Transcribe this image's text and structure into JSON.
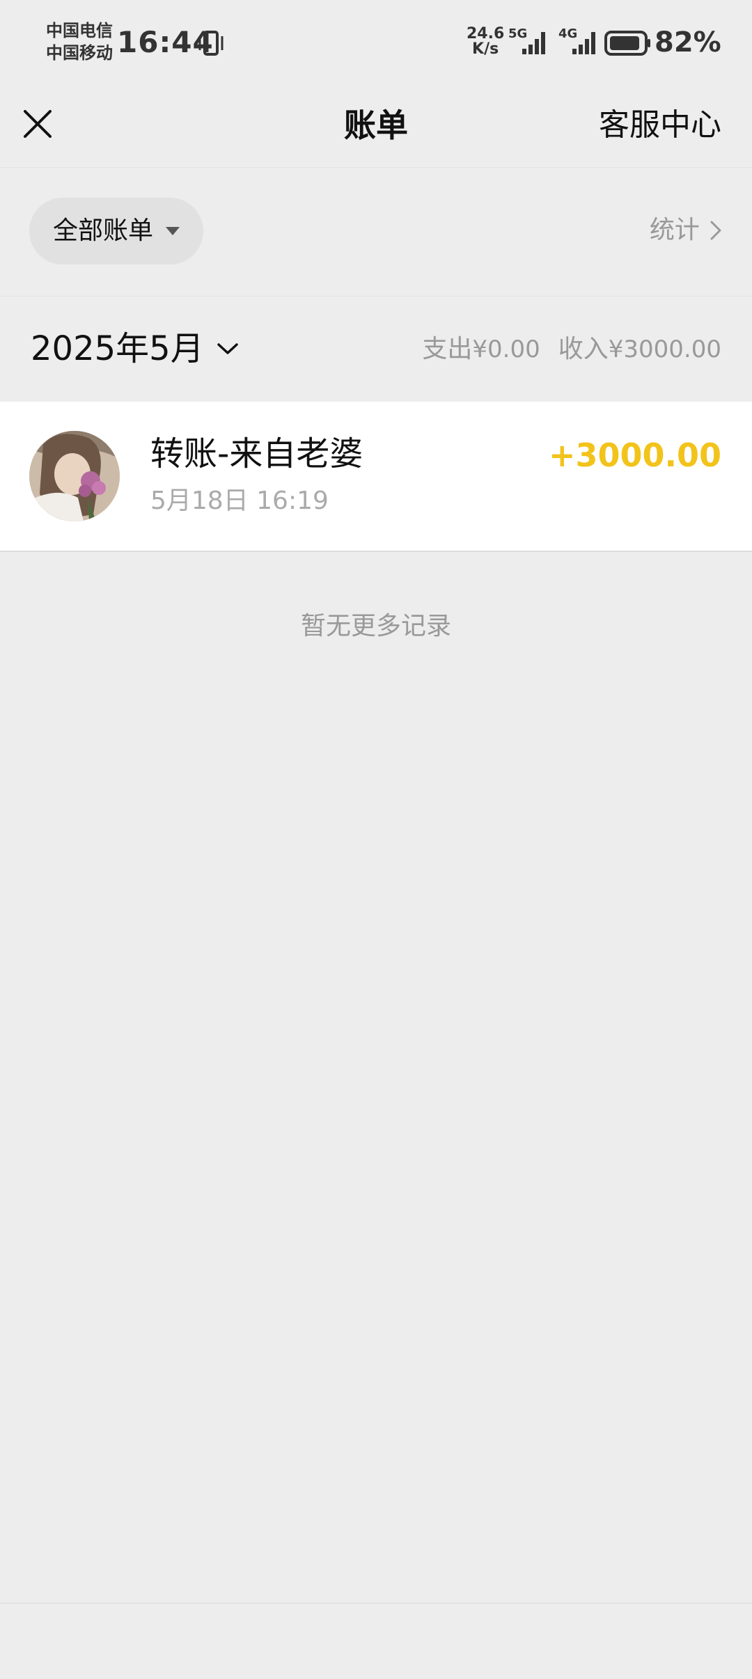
{
  "status_bar": {
    "carrier_1": "中国电信",
    "carrier_2": "中国移动",
    "time": "16:44",
    "net_speed_value": "24.6",
    "net_speed_unit": "K/s",
    "signal_1_label": "5G",
    "signal_2_label": "4G",
    "battery": "82%",
    "icons": [
      "vibrate-icon",
      "signal-5g-icon",
      "signal-4g-icon",
      "battery-icon"
    ]
  },
  "nav": {
    "title": "账单",
    "right_link": "客服中心",
    "close_icon": "close-icon"
  },
  "filter": {
    "chip_label": "全部账单",
    "stats_label": "统计"
  },
  "month": {
    "label": "2025年5月",
    "expense_label": "支出",
    "expense_amount": "¥0.00",
    "income_label": "收入",
    "income_amount": "¥3000.00"
  },
  "transactions": [
    {
      "title": "转账-来自老婆",
      "time": "5月18日 16:19",
      "amount": "+3000.00",
      "amount_color": "#F2C31A"
    }
  ],
  "empty_note": "暂无更多记录",
  "colors": {
    "background": "#EDEDED",
    "card": "#FFFFFF",
    "income": "#F2C31A",
    "muted_text": "#999999"
  }
}
